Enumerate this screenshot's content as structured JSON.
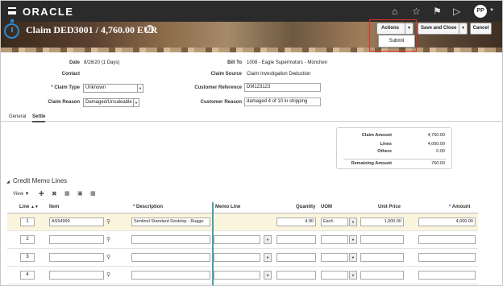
{
  "topbar": {
    "brand": "ORACLE",
    "icons": [
      "home-icon",
      "star-icon",
      "flag-icon",
      "play-icon",
      "bell-icon"
    ],
    "user_initials": "PP"
  },
  "header": {
    "title": "Claim DED3001 / 4,760.00 EUR",
    "help_glyph": "?",
    "actions_label": "Actions",
    "save_close_label": "Save and Close",
    "cancel_label": "Cancel",
    "actions_menu": [
      "Submit"
    ],
    "highlight_color": "#e0302a"
  },
  "form": {
    "date_label": "Date",
    "date_value": "8/28/20 (1 Days)",
    "contact_label": "Contact",
    "claim_type_label": "Claim Type",
    "claim_type_value": "Unknown",
    "claim_reason_label": "Claim Reason",
    "claim_reason_value": "Damaged/Unsaleable",
    "bill_to_label": "Bill To",
    "bill_to_value": "1008 - Eagle Supermotors - München",
    "claim_source_label": "Claim Source",
    "claim_source_value": "Claim Investigation Deduction",
    "customer_reference_label": "Customer Reference",
    "customer_reference_value": "DM123123",
    "customer_reason_label": "Customer Reason",
    "customer_reason_value": "damaged 4 of 10 in shipping"
  },
  "tabs": [
    {
      "label": "General"
    },
    {
      "label": "Settle"
    }
  ],
  "summary": {
    "claim_amount_label": "Claim Amount",
    "claim_amount": "4,760.00",
    "lines_label": "Lines",
    "lines": "4,000.00",
    "others_label": "Others",
    "others": "0.00",
    "remaining_label": "Remaining Amount",
    "remaining": "760.00"
  },
  "credit_memo": {
    "title": "Credit Memo Lines",
    "view_label": "View"
  },
  "table": {
    "headers": {
      "line": "Line",
      "item": "Item",
      "description": "Description",
      "memo_line": "Memo Line",
      "quantity": "Quantity",
      "uom": "UOM",
      "unit_price": "Unit Price",
      "amount": "Amount"
    },
    "rows": [
      {
        "line": "1",
        "item": "AS54999",
        "description": "Sentinel Standard Desktop - Rugge",
        "quantity": "4.00",
        "uom": "Each",
        "unit_price": "1,000.00",
        "amount": "4,000.00"
      },
      {
        "line": "2",
        "item": "",
        "description": "",
        "quantity": "",
        "uom": "",
        "unit_price": "",
        "amount": ""
      },
      {
        "line": "3",
        "item": "",
        "description": "",
        "quantity": "",
        "uom": "",
        "unit_price": "",
        "amount": ""
      },
      {
        "line": "4",
        "item": "",
        "description": "",
        "quantity": "",
        "uom": "",
        "unit_price": "",
        "amount": ""
      }
    ]
  }
}
